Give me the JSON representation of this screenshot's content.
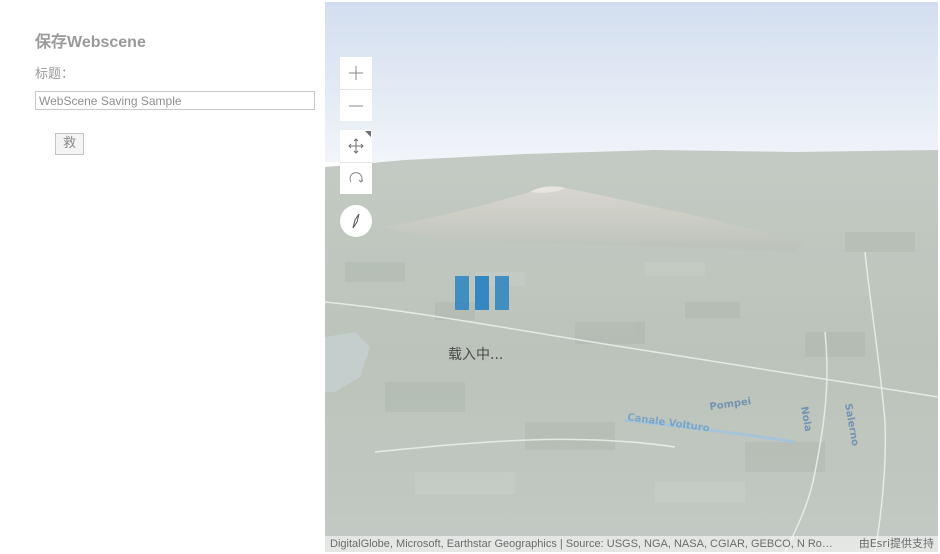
{
  "panel": {
    "title": "保存Webscene",
    "title_label": "标题：",
    "title_input_value": "WebScene Saving Sample",
    "save_button_label": "救"
  },
  "map": {
    "loading_text": "载入中...",
    "attribution": "DigitalGlobe, Microsoft, Earthstar Geographics | Source: USGS, NGA, NASA, CGIAR, GEBCO, N Robinson, NCEAS, NLS, OS, NMA, Geodatastyrelsen, Rijkswaterstaat, GSA, Geoland, FEMA, Intermap and the GIS user community",
    "powered_by": "由Esri提供支持",
    "labels": [
      "Pompei",
      "Nola",
      "Salerno",
      "Canale Volturo"
    ],
    "controls": {
      "zoom_in_icon": "plus-icon",
      "zoom_out_icon": "minus-icon",
      "pan_icon": "pan-arrows-icon",
      "rotate_icon": "rotate-icon",
      "compass_icon": "compass-needle-icon"
    },
    "colors": {
      "loader_accent": "#2b84c2",
      "sky_top": "#c6d5ec",
      "terrain": "#a9b3a8"
    }
  }
}
